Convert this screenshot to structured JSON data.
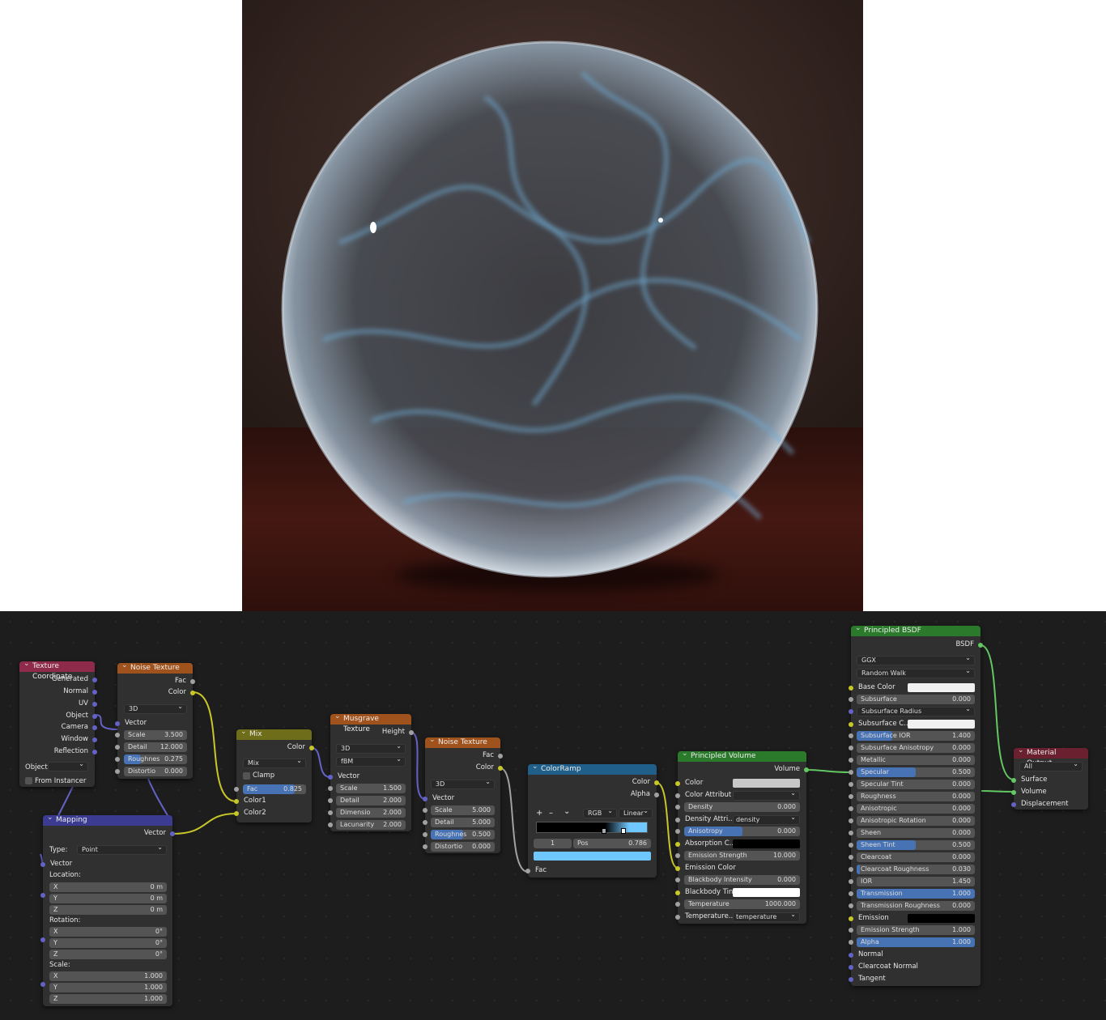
{
  "colors": {
    "tex_coord": "#8e2a4a",
    "noise": "#a0521c",
    "mix": "#6e6e1a",
    "mapping": "#3b3b91",
    "musgrave": "#a0521c",
    "colorramp": "#1f5f8a",
    "principled_volume": "#2b7a2b",
    "principled_bsdf": "#2b7a2b",
    "material_output": "#6b2030"
  },
  "tex_coord": {
    "title": "Texture Coordinate",
    "outputs": [
      "Generated",
      "Normal",
      "UV",
      "Object",
      "Camera",
      "Window",
      "Reflection"
    ],
    "object_label": "Object",
    "from_instancer": "From Instancer"
  },
  "noise1": {
    "title": "Noise Texture",
    "outputs": [
      "Fac",
      "Color"
    ],
    "dim": "3D",
    "vector": "Vector",
    "fields": [
      {
        "label": "Scale",
        "value": "3.500"
      },
      {
        "label": "Detail",
        "value": "12.000"
      },
      {
        "label": "Roughnes",
        "value": "0.275"
      },
      {
        "label": "Distortio",
        "value": "0.000"
      }
    ]
  },
  "mix": {
    "title": "Mix",
    "output": "Color",
    "blend": "Mix",
    "clamp": "Clamp",
    "fac_label": "Fac",
    "fac_value": "0.825",
    "fac_fraction": 0.825,
    "color1": "Color1",
    "color2": "Color2"
  },
  "mapping": {
    "title": "Mapping",
    "output": "Vector",
    "type_label": "Type:",
    "type_value": "Point",
    "vector": "Vector",
    "location": "Location:",
    "rotation": "Rotation:",
    "scale": "Scale:",
    "loc": [
      {
        "a": "X",
        "v": "0 m"
      },
      {
        "a": "Y",
        "v": "0 m"
      },
      {
        "a": "Z",
        "v": "0 m"
      }
    ],
    "rot": [
      {
        "a": "X",
        "v": "0°"
      },
      {
        "a": "Y",
        "v": "0°"
      },
      {
        "a": "Z",
        "v": "0°"
      }
    ],
    "scl": [
      {
        "a": "X",
        "v": "1.000"
      },
      {
        "a": "Y",
        "v": "1.000"
      },
      {
        "a": "Z",
        "v": "1.000"
      }
    ]
  },
  "musgrave": {
    "title": "Musgrave Texture",
    "output": "Height",
    "dim": "3D",
    "type": "fBM",
    "vector": "Vector",
    "fields": [
      {
        "label": "Scale",
        "value": "1.500"
      },
      {
        "label": "Detail",
        "value": "2.000"
      },
      {
        "label": "Dimensio",
        "value": "2.000"
      },
      {
        "label": "Lacunarity",
        "value": "2.000"
      }
    ]
  },
  "noise2": {
    "title": "Noise Texture",
    "outputs": [
      "Fac",
      "Color"
    ],
    "dim": "3D",
    "vector": "Vector",
    "fields": [
      {
        "label": "Scale",
        "value": "5.000"
      },
      {
        "label": "Detail",
        "value": "5.000"
      },
      {
        "label": "Roughnes",
        "value": "0.500"
      },
      {
        "label": "Distortio",
        "value": "0.000"
      }
    ]
  },
  "colorramp": {
    "title": "ColorRamp",
    "outputs": [
      "Color",
      "Alpha"
    ],
    "add": "+",
    "remove": "–",
    "menu": "⌄",
    "mode": "RGB",
    "interp": "Linear",
    "index": "1",
    "pos_label": "Pos",
    "pos_value": "0.786",
    "input": "Fac"
  },
  "pvolume": {
    "title": "Principled Volume",
    "output": "Volume",
    "color": "Color",
    "color_attr": "Color Attribut",
    "density": {
      "label": "Density",
      "value": "0.000"
    },
    "density_attr_label": "Density Attri...",
    "density_attr": "density",
    "anisotropy": {
      "label": "Anisotropy",
      "value": "0.000"
    },
    "absorption": "Absorption C...",
    "emission_strength": {
      "label": "Emission Strength",
      "value": "10.000"
    },
    "emission_color": "Emission Color",
    "blackbody": {
      "label": "Blackbody Intensity",
      "value": "0.000"
    },
    "blackbody_tint": "Blackbody Tint",
    "temperature": {
      "label": "Temperature",
      "value": "1000.000"
    },
    "temp_attr_label": "Temperature...",
    "temp_attr": "temperature"
  },
  "bsdf": {
    "title": "Principled BSDF",
    "output": "BSDF",
    "distribution": "GGX",
    "subsurface_method": "Random Walk",
    "base_color": "Base Color",
    "subsurface": {
      "label": "Subsurface",
      "value": "0.000"
    },
    "subsurface_radius": "Subsurface Radius",
    "subsurface_color": "Subsurface C...",
    "rows": [
      {
        "label": "Subsurface IOR",
        "value": "1.400",
        "fill": 0.3
      },
      {
        "label": "Subsurface Anisotropy",
        "value": "0.000",
        "fill": 0
      },
      {
        "label": "Metallic",
        "value": "0.000",
        "fill": 0
      },
      {
        "label": "Specular",
        "value": "0.500",
        "fill": 0.5
      },
      {
        "label": "Specular Tint",
        "value": "0.000",
        "fill": 0
      },
      {
        "label": "Roughness",
        "value": "0.000",
        "fill": 0
      },
      {
        "label": "Anisotropic",
        "value": "0.000",
        "fill": 0
      },
      {
        "label": "Anisotropic Rotation",
        "value": "0.000",
        "fill": 0
      },
      {
        "label": "Sheen",
        "value": "0.000",
        "fill": 0
      },
      {
        "label": "Sheen Tint",
        "value": "0.500",
        "fill": 0.5
      },
      {
        "label": "Clearcoat",
        "value": "0.000",
        "fill": 0
      },
      {
        "label": "Clearcoat Roughness",
        "value": "0.030",
        "fill": 0.03
      },
      {
        "label": "IOR",
        "value": "1.450",
        "fill": 0
      },
      {
        "label": "Transmission",
        "value": "1.000",
        "fill": 1
      },
      {
        "label": "Transmission Roughness",
        "value": "0.000",
        "fill": 0
      }
    ],
    "emission": "Emission",
    "emission_strength": {
      "label": "Emission Strength",
      "value": "1.000"
    },
    "alpha": {
      "label": "Alpha",
      "value": "1.000"
    },
    "normal": "Normal",
    "clearcoat_normal": "Clearcoat Normal",
    "tangent": "Tangent"
  },
  "matout": {
    "title": "Material Output",
    "target": "All",
    "inputs": [
      "Surface",
      "Volume",
      "Displacement"
    ]
  }
}
